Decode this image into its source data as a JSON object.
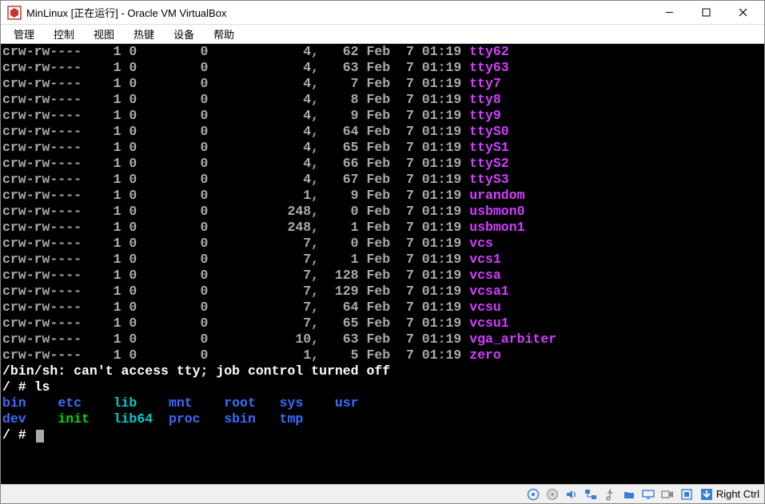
{
  "window": {
    "title": "MinLinux [正在运行] - Oracle VM VirtualBox"
  },
  "menu": {
    "items": [
      "管理",
      "控制",
      "视图",
      "热键",
      "设备",
      "帮助"
    ]
  },
  "ls_rows": [
    {
      "perm": "crw-rw----",
      "links": "1",
      "own": "0",
      "grp": "0",
      "maj": "4,",
      "min": "62",
      "mon": "Feb",
      "day": "7",
      "time": "01:19",
      "name": "tty62"
    },
    {
      "perm": "crw-rw----",
      "links": "1",
      "own": "0",
      "grp": "0",
      "maj": "4,",
      "min": "63",
      "mon": "Feb",
      "day": "7",
      "time": "01:19",
      "name": "tty63"
    },
    {
      "perm": "crw-rw----",
      "links": "1",
      "own": "0",
      "grp": "0",
      "maj": "4,",
      "min": "7",
      "mon": "Feb",
      "day": "7",
      "time": "01:19",
      "name": "tty7"
    },
    {
      "perm": "crw-rw----",
      "links": "1",
      "own": "0",
      "grp": "0",
      "maj": "4,",
      "min": "8",
      "mon": "Feb",
      "day": "7",
      "time": "01:19",
      "name": "tty8"
    },
    {
      "perm": "crw-rw----",
      "links": "1",
      "own": "0",
      "grp": "0",
      "maj": "4,",
      "min": "9",
      "mon": "Feb",
      "day": "7",
      "time": "01:19",
      "name": "tty9"
    },
    {
      "perm": "crw-rw----",
      "links": "1",
      "own": "0",
      "grp": "0",
      "maj": "4,",
      "min": "64",
      "mon": "Feb",
      "day": "7",
      "time": "01:19",
      "name": "ttyS0"
    },
    {
      "perm": "crw-rw----",
      "links": "1",
      "own": "0",
      "grp": "0",
      "maj": "4,",
      "min": "65",
      "mon": "Feb",
      "day": "7",
      "time": "01:19",
      "name": "ttyS1"
    },
    {
      "perm": "crw-rw----",
      "links": "1",
      "own": "0",
      "grp": "0",
      "maj": "4,",
      "min": "66",
      "mon": "Feb",
      "day": "7",
      "time": "01:19",
      "name": "ttyS2"
    },
    {
      "perm": "crw-rw----",
      "links": "1",
      "own": "0",
      "grp": "0",
      "maj": "4,",
      "min": "67",
      "mon": "Feb",
      "day": "7",
      "time": "01:19",
      "name": "ttyS3"
    },
    {
      "perm": "crw-rw----",
      "links": "1",
      "own": "0",
      "grp": "0",
      "maj": "1,",
      "min": "9",
      "mon": "Feb",
      "day": "7",
      "time": "01:19",
      "name": "urandom"
    },
    {
      "perm": "crw-rw----",
      "links": "1",
      "own": "0",
      "grp": "0",
      "maj": "248,",
      "min": "0",
      "mon": "Feb",
      "day": "7",
      "time": "01:19",
      "name": "usbmon0"
    },
    {
      "perm": "crw-rw----",
      "links": "1",
      "own": "0",
      "grp": "0",
      "maj": "248,",
      "min": "1",
      "mon": "Feb",
      "day": "7",
      "time": "01:19",
      "name": "usbmon1"
    },
    {
      "perm": "crw-rw----",
      "links": "1",
      "own": "0",
      "grp": "0",
      "maj": "7,",
      "min": "0",
      "mon": "Feb",
      "day": "7",
      "time": "01:19",
      "name": "vcs"
    },
    {
      "perm": "crw-rw----",
      "links": "1",
      "own": "0",
      "grp": "0",
      "maj": "7,",
      "min": "1",
      "mon": "Feb",
      "day": "7",
      "time": "01:19",
      "name": "vcs1"
    },
    {
      "perm": "crw-rw----",
      "links": "1",
      "own": "0",
      "grp": "0",
      "maj": "7,",
      "min": "128",
      "mon": "Feb",
      "day": "7",
      "time": "01:19",
      "name": "vcsa"
    },
    {
      "perm": "crw-rw----",
      "links": "1",
      "own": "0",
      "grp": "0",
      "maj": "7,",
      "min": "129",
      "mon": "Feb",
      "day": "7",
      "time": "01:19",
      "name": "vcsa1"
    },
    {
      "perm": "crw-rw----",
      "links": "1",
      "own": "0",
      "grp": "0",
      "maj": "7,",
      "min": "64",
      "mon": "Feb",
      "day": "7",
      "time": "01:19",
      "name": "vcsu"
    },
    {
      "perm": "crw-rw----",
      "links": "1",
      "own": "0",
      "grp": "0",
      "maj": "7,",
      "min": "65",
      "mon": "Feb",
      "day": "7",
      "time": "01:19",
      "name": "vcsu1"
    },
    {
      "perm": "crw-rw----",
      "links": "1",
      "own": "0",
      "grp": "0",
      "maj": "10,",
      "min": "63",
      "mon": "Feb",
      "day": "7",
      "time": "01:19",
      "name": "vga_arbiter"
    },
    {
      "perm": "crw-rw----",
      "links": "1",
      "own": "0",
      "grp": "0",
      "maj": "1,",
      "min": "5",
      "mon": "Feb",
      "day": "7",
      "time": "01:19",
      "name": "zero"
    }
  ],
  "messages": {
    "job_ctrl": "/bin/sh: can't access tty; job control turned off",
    "prompt1": "/ # ls",
    "prompt2": "/ # "
  },
  "root_ls": {
    "row1": [
      {
        "name": "bin",
        "cls": "dir"
      },
      {
        "name": "etc",
        "cls": "dir"
      },
      {
        "name": "lib",
        "cls": "tl"
      },
      {
        "name": "mnt",
        "cls": "dir"
      },
      {
        "name": "root",
        "cls": "dir"
      },
      {
        "name": "sys",
        "cls": "dir"
      },
      {
        "name": "usr",
        "cls": "dir"
      }
    ],
    "row2": [
      {
        "name": "dev",
        "cls": "dir"
      },
      {
        "name": "init",
        "cls": "exe"
      },
      {
        "name": "lib64",
        "cls": "tl"
      },
      {
        "name": "proc",
        "cls": "dir"
      },
      {
        "name": "sbin",
        "cls": "dir"
      },
      {
        "name": "tmp",
        "cls": "dir"
      }
    ]
  },
  "status": {
    "hint": "Right Ctrl"
  },
  "colors": {
    "filename": "#d13fff",
    "dir": "#3c6cff",
    "exec": "#00d800",
    "teal": "#00cccc",
    "term_bg": "#000000",
    "term_fg": "#aaaaaa"
  }
}
